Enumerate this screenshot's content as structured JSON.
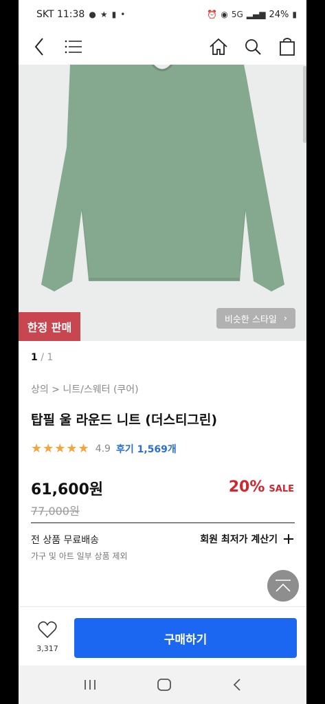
{
  "status_bar": {
    "carrier_time": "SKT 11:38",
    "battery": "24%",
    "network": "5G"
  },
  "app_bar": {
    "back_icon": "back-chevron-icon",
    "menu_icon": "hamburger-menu-icon",
    "home_icon": "home-icon",
    "search_icon": "search-icon",
    "bag_icon": "shopping-bag-icon"
  },
  "hero": {
    "badge": "한정 판매",
    "similar_button": "비슷한 스타일",
    "product_color": "#85a98f"
  },
  "pager": {
    "current": "1",
    "separator": " / ",
    "total": "1"
  },
  "product": {
    "breadcrumb": "상의 > 니트/스웨터 (쿠어)",
    "title": "탑필 울 라운드 니트 (더스티그린)",
    "rating_stars": 5,
    "rating_value": "4.9",
    "reviews": "후기 1,569개",
    "price": "61,600원",
    "discount_percent": "20%",
    "discount_label": "SALE",
    "original_price": "77,000원"
  },
  "shipping": {
    "title": "전 상품 무료배송",
    "note": "가구 및 아트 일부 상품 제외",
    "member_calc": "회원 최저가 계산기"
  },
  "bottom_bar": {
    "like_count": "3,317",
    "buy_label": "구매하기"
  },
  "colors": {
    "accent_blue": "#1b67f2",
    "sale_red": "#d0262d",
    "badge_red": "#c8464f",
    "star_orange": "#f4a43b"
  }
}
